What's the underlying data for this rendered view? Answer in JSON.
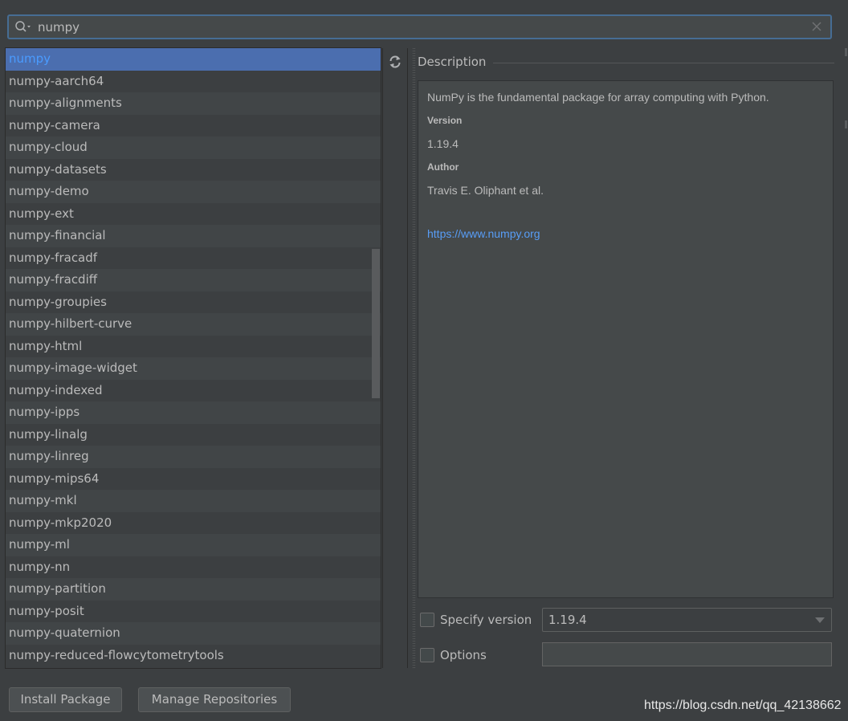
{
  "search": {
    "value": "numpy",
    "icon": "search-icon",
    "clear_icon": "close-icon"
  },
  "packages": [
    "numpy",
    "numpy-aarch64",
    "numpy-alignments",
    "numpy-camera",
    "numpy-cloud",
    "numpy-datasets",
    "numpy-demo",
    "numpy-ext",
    "numpy-financial",
    "numpy-fracadf",
    "numpy-fracdiff",
    "numpy-groupies",
    "numpy-hilbert-curve",
    "numpy-html",
    "numpy-image-widget",
    "numpy-indexed",
    "numpy-ipps",
    "numpy-linalg",
    "numpy-linreg",
    "numpy-mips64",
    "numpy-mkl",
    "numpy-mkp2020",
    "numpy-ml",
    "numpy-nn",
    "numpy-partition",
    "numpy-posit",
    "numpy-quaternion",
    "numpy-reduced-flowcytometrytools"
  ],
  "selected_index": 0,
  "refresh_icon": "refresh-icon",
  "description": {
    "title": "Description",
    "summary": "NumPy is the fundamental package for array computing with Python.",
    "version_label": "Version",
    "version": "1.19.4",
    "author_label": "Author",
    "author": "Travis E. Oliphant et al.",
    "link": "https://www.numpy.org"
  },
  "options": {
    "specify_version_label": "Specify version",
    "specify_version_checked": false,
    "version_selected": "1.19.4",
    "options_label": "Options",
    "options_checked": false,
    "options_value": ""
  },
  "buttons": {
    "install": "Install Package",
    "manage": "Manage Repositories"
  },
  "watermark": "https://blog.csdn.net/qq_42138662",
  "colors": {
    "background": "#3c3f41",
    "selection": "#4b6eaf",
    "link": "#589df6",
    "focus_border": "#466d94"
  }
}
